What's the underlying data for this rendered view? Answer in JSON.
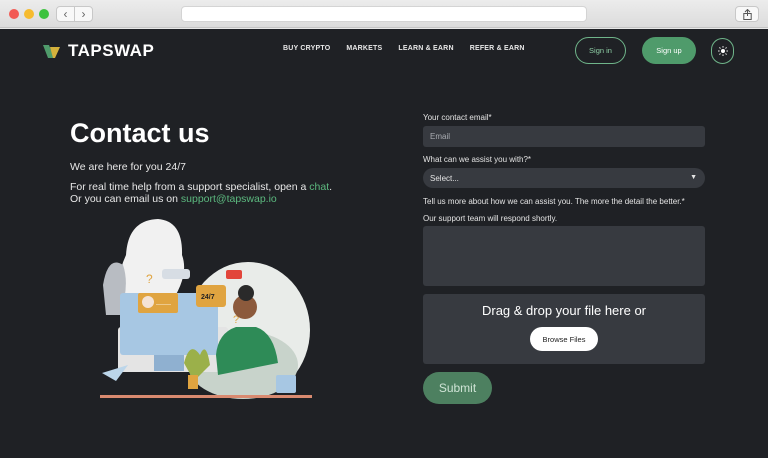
{
  "browser": {
    "back_icon": "chevron-left-icon",
    "forward_icon": "chevron-right-icon",
    "share_icon": "share-icon"
  },
  "header": {
    "logo_text": "TAPSWAP",
    "menu": [
      {
        "label": "BUY CRYPTO"
      },
      {
        "label": "MARKETS"
      },
      {
        "label": "LEARN & EARN"
      },
      {
        "label": "REFER & EARN"
      }
    ],
    "sign_in": "Sign in",
    "sign_up": "Sign up",
    "theme_icon": "sun-icon"
  },
  "contact": {
    "title": "Contact us",
    "subtitle": "We are here for you 24/7",
    "line1_prefix": "For real time help from a support specialist, open a ",
    "chat_link": "chat",
    "line1_suffix": ".",
    "line2_prefix": "Or you can email us on ",
    "email_link": "support@tapswap.io"
  },
  "illustration": {
    "badge_text": "24/7"
  },
  "form": {
    "email_label": "Your contact email*",
    "email_placeholder": "Email",
    "assist_label": "What can we assist you with?*",
    "assist_value": "Select...",
    "details_label": "Tell us more about how we can assist you. The more the detail the better.*",
    "details_note": "Our support team will respond shortly.",
    "drop_text": "Drag & drop your file here or",
    "browse_label": "Browse Files",
    "submit_label": "Submit"
  },
  "colors": {
    "accent": "#4f9b6b",
    "link": "#5cb97f",
    "background": "#1f2125",
    "field": "#373a40"
  }
}
